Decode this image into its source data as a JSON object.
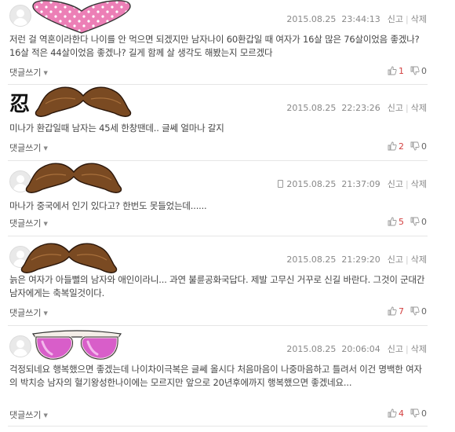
{
  "labels": {
    "report": "신고",
    "delete": "삭제",
    "reply": "댓글쓰기"
  },
  "comments": [
    {
      "date": "2015.08.25",
      "time": "23:44:13",
      "text": "저런 걸 역혼이라한다 나이를 안 먹으면 되겠지만 남자나이 60환갑일 때 여자가 16살 많은 76살이었음 좋겠나? 16살 적은 44살이었음 좋겠나? 길게 함께 살 생각도 해봤는지 모르겠다",
      "up": "1",
      "down": "0",
      "decoration": "pink-polka-heart"
    },
    {
      "date": "2015.08.25",
      "time": "22:23:26",
      "text": "미나가 환갑일때 남자는 45세 한창땐데.. 글쎄 얼마나 갈지",
      "up": "2",
      "down": "0",
      "decoration": "mustache",
      "badge": "忍"
    },
    {
      "date": "2015.08.25",
      "time": "21:37:09",
      "text": "마나가 중국에서 인기 있다고? 한번도 못들었는데......",
      "up": "5",
      "down": "0",
      "decoration": "mustache",
      "mobile": true
    },
    {
      "date": "2015.08.25",
      "time": "21:29:20",
      "text": "늙은 여자가 아들뻘의 남자와 애인이라니... 과연 불륜공화국답다. 제발 고무신 거꾸로 신길 바란다. 그것이 군대간 남자에게는 축복일것이다.",
      "up": "7",
      "down": "0",
      "decoration": "mustache"
    },
    {
      "date": "2015.08.25",
      "time": "20:06:04",
      "text": "걱정되네요 행복했으면 좋겠는데 나이차이극복은 글쎄 올시다 처음마음이 나중마음하고 틀려서 이건 명백한 여자의 박치승 남자의 혈기왕성한나이에는 모르지만 앞으로 20년후에까지 행복했으면 좋겠네요...",
      "up": "4",
      "down": "0",
      "decoration": "pink-sunglasses"
    }
  ],
  "colors": {
    "up": "#d34040",
    "mustache": "#7a4a22",
    "heart": "#ec7fb6",
    "glasses": "#d85ec9"
  }
}
